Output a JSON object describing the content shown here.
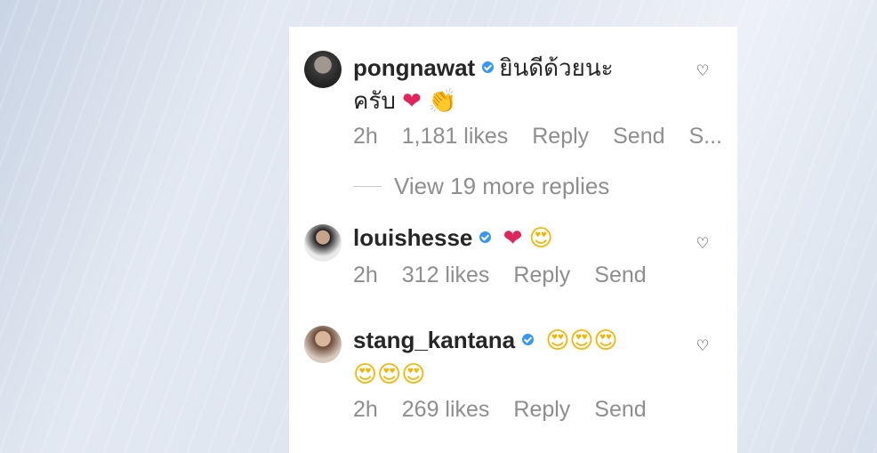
{
  "comments": [
    {
      "username": "pongnawat",
      "text_line1": "ยินดีด้วยนะ",
      "text_line2": "ครับ",
      "emojis": [
        "red-heart",
        "clapping-hands"
      ],
      "time": "2h",
      "likes": "1,181 likes",
      "reply": "Reply",
      "send": "Send",
      "extra": "S..."
    },
    {
      "username": "louishesse",
      "emojis": [
        "red-heart",
        "heart-eyes"
      ],
      "time": "2h",
      "likes": "312 likes",
      "reply": "Reply",
      "send": "Send"
    },
    {
      "username": "stang_kantana",
      "emojis": [
        "heart-eyes",
        "heart-eyes",
        "heart-eyes",
        "heart-eyes",
        "heart-eyes",
        "heart-eyes"
      ],
      "time": "2h",
      "likes": "269 likes",
      "reply": "Reply",
      "send": "Send"
    }
  ],
  "view_more_replies": "View 19 more replies",
  "colors": {
    "verified": "#3897f0",
    "meta_text": "#8e8e8e",
    "username": "#262626"
  },
  "icons": {
    "like": "heart-outline-icon",
    "verified": "verified-badge-icon"
  }
}
